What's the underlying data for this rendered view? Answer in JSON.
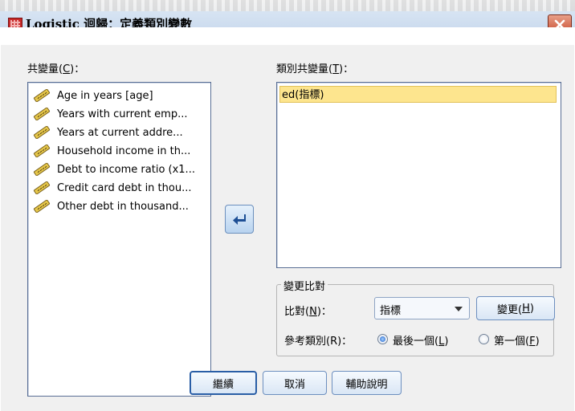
{
  "window": {
    "title": "Logistic 迴歸：定義類別變數",
    "app_icon": "grid-table-icon",
    "close_icon": "close-icon"
  },
  "covariates": {
    "label_prefix": "共變量(",
    "label_key": "C",
    "label_suffix": ")：",
    "items": [
      "Age in years [age]",
      "Years with current emp...",
      "Years at current addre...",
      "Household income in th...",
      "Debt to income ratio (x1...",
      "Credit card debt in thou...",
      "Other debt in thousand..."
    ],
    "item_icon": "scale-ruler-icon"
  },
  "move_button": {
    "icon": "arrow-left-icon"
  },
  "categorical": {
    "label_prefix": "類別共變量(",
    "label_key": "T",
    "label_suffix": ")：",
    "items": [
      "ed(指標)"
    ]
  },
  "change_contrast": {
    "title": "變更比對",
    "contrast_label_prefix": "比對(",
    "contrast_key": "N",
    "contrast_label_suffix": ")：",
    "contrast_value": "指標",
    "change_button_prefix": "變更(",
    "change_button_key": "H",
    "change_button_suffix": ")",
    "reference_label": "參考類別(R)：",
    "ref_last_prefix": "最後一個(",
    "ref_last_key": "L",
    "ref_last_suffix": ")",
    "ref_first_prefix": "第一個(",
    "ref_first_key": "F",
    "ref_first_suffix": ")",
    "selected_reference": "last"
  },
  "buttons": {
    "continue": "繼續",
    "cancel": "取消",
    "help": "輔助說明"
  },
  "colors": {
    "selection": "#fde58e",
    "title_bar": "#c2d4ea",
    "dialog_bg": "#f0f0f0"
  }
}
